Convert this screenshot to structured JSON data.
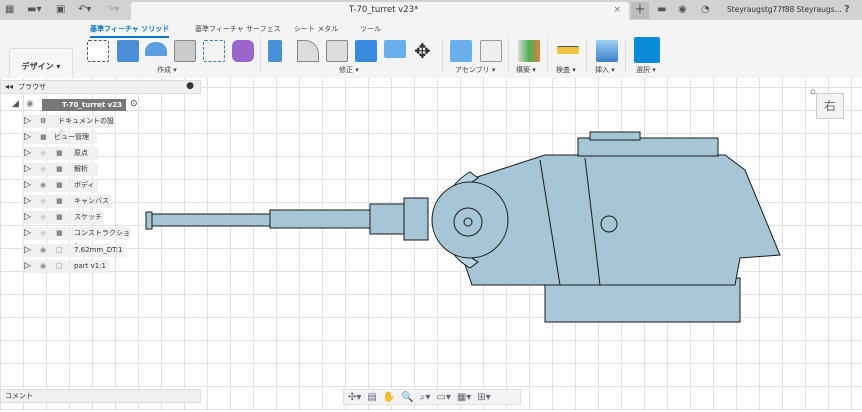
{
  "titlebar": {
    "doc_title": "T-70_turret v23*",
    "user": "Steyraugstg77f88 Steyraugs...",
    "close": "×",
    "new_tab": "+",
    "help": "?"
  },
  "toolbar": {
    "workspace": "デザイン ▾",
    "tabs": [
      "基準フィーチャ ソリッド",
      "基準フィーチャ サーフェス",
      "シート メタル",
      "ツール"
    ],
    "groups": [
      "作成 ▾",
      "修正 ▾",
      "アセンブリ ▾",
      "構築 ▾",
      "検査 ▾",
      "挿入 ▾",
      "選択 ▾"
    ]
  },
  "browser": {
    "title": "ブラウザ",
    "root": "T-70_turret v23",
    "items": [
      {
        "label": "ドキュメントの設定",
        "icon": "gear",
        "eye": "none"
      },
      {
        "label": "ビュー管理",
        "icon": "folder",
        "eye": "none"
      },
      {
        "label": "原点",
        "icon": "folder",
        "eye": "hidden"
      },
      {
        "label": "解析",
        "icon": "folder",
        "eye": "hidden"
      },
      {
        "label": "ボディ",
        "icon": "folder",
        "eye": "visible"
      },
      {
        "label": "キャンバス",
        "icon": "folder",
        "eye": "hidden"
      },
      {
        "label": "スケッチ",
        "icon": "folder",
        "eye": "hidden"
      },
      {
        "label": "コンストラクション",
        "icon": "folder",
        "eye": "hidden"
      },
      {
        "label": "7.62mm_DT:1",
        "icon": "component",
        "eye": "visible"
      },
      {
        "label": "part v1:1",
        "icon": "component",
        "eye": "visible"
      }
    ]
  },
  "comment": {
    "label": "コメント"
  },
  "viewcube": {
    "face": "右"
  },
  "colors": {
    "accent": "#0a75c2",
    "model": "#a6c6d6"
  }
}
